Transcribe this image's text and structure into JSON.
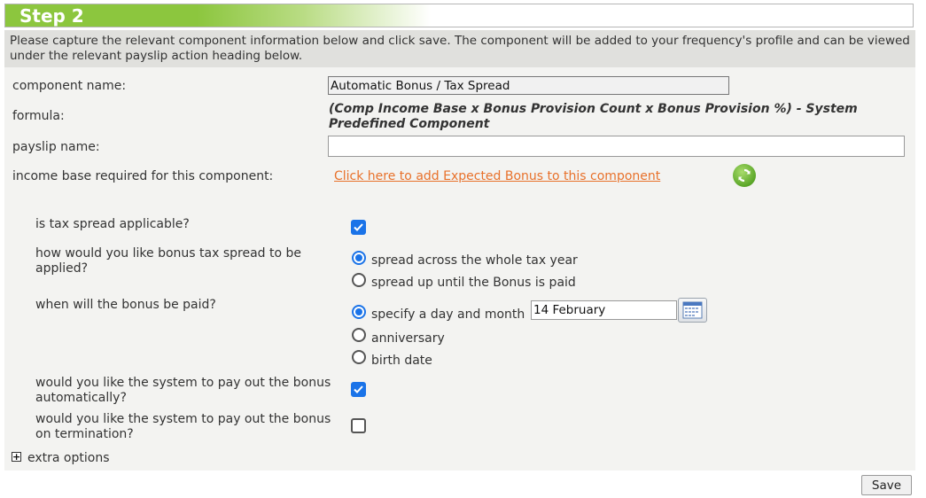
{
  "header": {
    "title": "Step 2"
  },
  "intro": "Please capture the relevant component information below and click save. The component will be added to your frequency's profile and can be viewed under the relevant payslip action heading below.",
  "fields": {
    "component_name_label": "component name:",
    "component_name_value": "Automatic Bonus / Tax Spread",
    "formula_label": "formula:",
    "formula_value": "(Comp Income Base x Bonus Provision Count x Bonus Provision %) - System Predefined Component",
    "payslip_name_label": "payslip name:",
    "payslip_name_value": "",
    "income_base_label": "income base required for this component:",
    "income_base_link": "Click here to add Expected Bonus to this component"
  },
  "tax_spread": {
    "applicable_label": "is tax spread applicable?",
    "applicable_checked": true,
    "how_label": "how would you like bonus tax spread to be applied?",
    "how_options": [
      {
        "label": "spread across the whole tax year",
        "selected": true
      },
      {
        "label": "spread up until the Bonus is paid",
        "selected": false
      }
    ],
    "when_label": "when will the bonus be paid?",
    "when_options": [
      {
        "label": "specify a day and month",
        "selected": true
      },
      {
        "label": "anniversary",
        "selected": false
      },
      {
        "label": "birth date",
        "selected": false
      }
    ],
    "date_value": "14 February",
    "auto_pay_label": "would you like the system to pay out the bonus automatically?",
    "auto_pay_checked": true,
    "termination_label": "would you like the system to pay out the bonus on termination?",
    "termination_checked": false
  },
  "extra_options_label": "extra options",
  "save_label": "Save",
  "colors": {
    "accent_green": "#8cc63e",
    "link_orange": "#e8712b",
    "check_blue": "#1a73e8"
  },
  "icons": [
    "refresh-icon",
    "calendar-icon",
    "checkmark-icon",
    "plus-icon"
  ]
}
